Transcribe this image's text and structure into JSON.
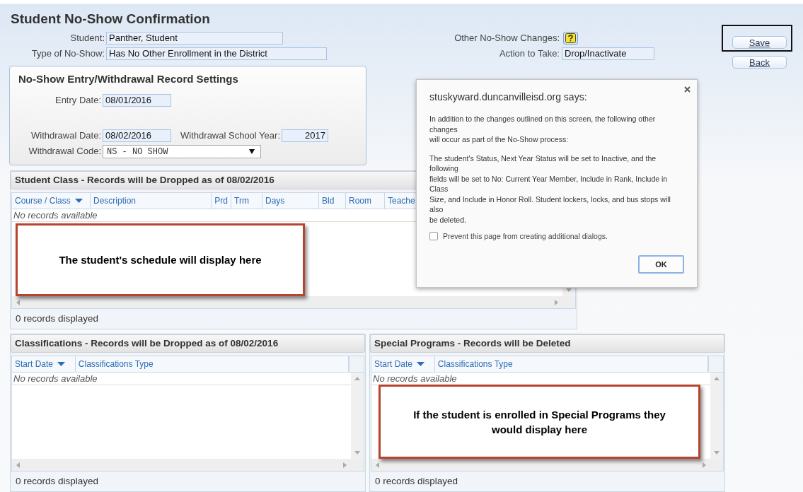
{
  "page": {
    "title": "Student No-Show Confirmation"
  },
  "student_fields": [
    {
      "label": "Student:",
      "value": "Panther, Student"
    },
    {
      "label": "Type of No-Show:",
      "value": "Has No Other Enrollment in the District"
    }
  ],
  "other_changes": {
    "label": "Other No-Show Changes:"
  },
  "action": {
    "label": "Action to Take:",
    "value": "Drop/Inactivate"
  },
  "buttons": [
    {
      "label": "Save",
      "highlighted": true
    },
    {
      "label": "Back",
      "highlighted": false
    }
  ],
  "settings": {
    "title": "No-Show Entry/Withdrawal Record Settings",
    "entry_date": {
      "label": "Entry Date:",
      "value": "08/01/2016"
    },
    "withdrawal_date": {
      "label": "Withdrawal Date:",
      "value": "08/02/2016"
    },
    "withdrawal_school_year": {
      "label": "Withdrawal School Year:",
      "value": "2017"
    },
    "withdrawal_code": {
      "label": "Withdrawal Code:",
      "value": "NS - NO SHOW"
    }
  },
  "panels": [
    {
      "title": "Student Class - Records will be Dropped as of 08/02/2016",
      "columns": [
        {
          "label": "Course / Class",
          "sorted": true
        },
        {
          "label": "Description",
          "sorted": false
        },
        {
          "label": "Prd",
          "sorted": false
        },
        {
          "label": "Trm",
          "sorted": false
        },
        {
          "label": "Days",
          "sorted": false
        },
        {
          "label": "Bld",
          "sorted": false
        },
        {
          "label": "Room",
          "sorted": false
        },
        {
          "label": "Teache"
        }
      ],
      "empty_text": "No records available",
      "footer": "0 records displayed"
    },
    {
      "title": "Classifications - Records will be Dropped as of 08/02/2016",
      "columns": [
        {
          "label": "Start Date",
          "sorted": true
        },
        {
          "label": "Classifications Type",
          "sorted": false
        }
      ],
      "empty_text": "No records available",
      "footer": "0 records displayed"
    },
    {
      "title": "Special Programs - Records will be Deleted",
      "columns": [
        {
          "label": "Start Date",
          "sorted": true
        },
        {
          "label": "Classifications Type",
          "sorted": false
        }
      ],
      "empty_text": "No records available",
      "footer": "0 records displayed"
    }
  ],
  "callouts": [
    {
      "text": "The student's schedule will display here"
    },
    {
      "text": "If the student is enrolled in Special Programs they would display here"
    }
  ],
  "dialog": {
    "title": "stuskyward.duncanvilleisd.org says:",
    "paragraphs": [
      [
        "In addition to the changes outlined on this screen, the following other",
        "changes",
        "will occur as part of the No-Show process:"
      ],
      [
        "The student's Status, Next Year Status will be set to Inactive, and the",
        "following",
        "fields will be set to No: Current Year Member, Include in Rank, Include in",
        "Class",
        "Size, and Include in Honor Roll. Student lockers, locks, and bus stops will",
        "also",
        "be deleted."
      ]
    ],
    "checkbox": {
      "label": "Prevent this page from creating additional dialogs.",
      "checked": false
    },
    "button": "OK"
  }
}
